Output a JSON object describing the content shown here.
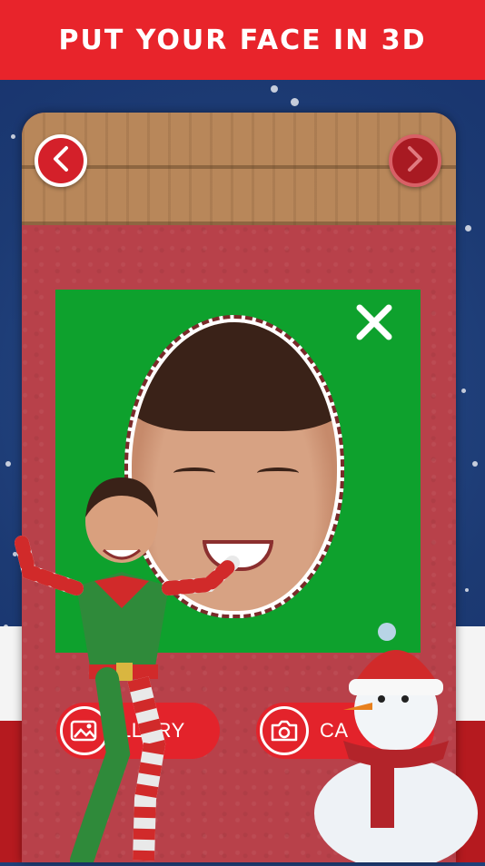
{
  "banner": {
    "title": "PUT YOUR FACE IN 3D"
  },
  "nav": {
    "prev_icon": "chevron-left-icon",
    "next_icon": "chevron-right-icon"
  },
  "photo": {
    "close_icon": "close-icon"
  },
  "actions": {
    "gallery_label": "LLERY",
    "camera_label": "CA"
  },
  "colors": {
    "banner": "#e8242b",
    "card": "#b8414a",
    "photo_bg": "#0ea12d",
    "button": "#e3232b",
    "background": "#1f3f78"
  }
}
